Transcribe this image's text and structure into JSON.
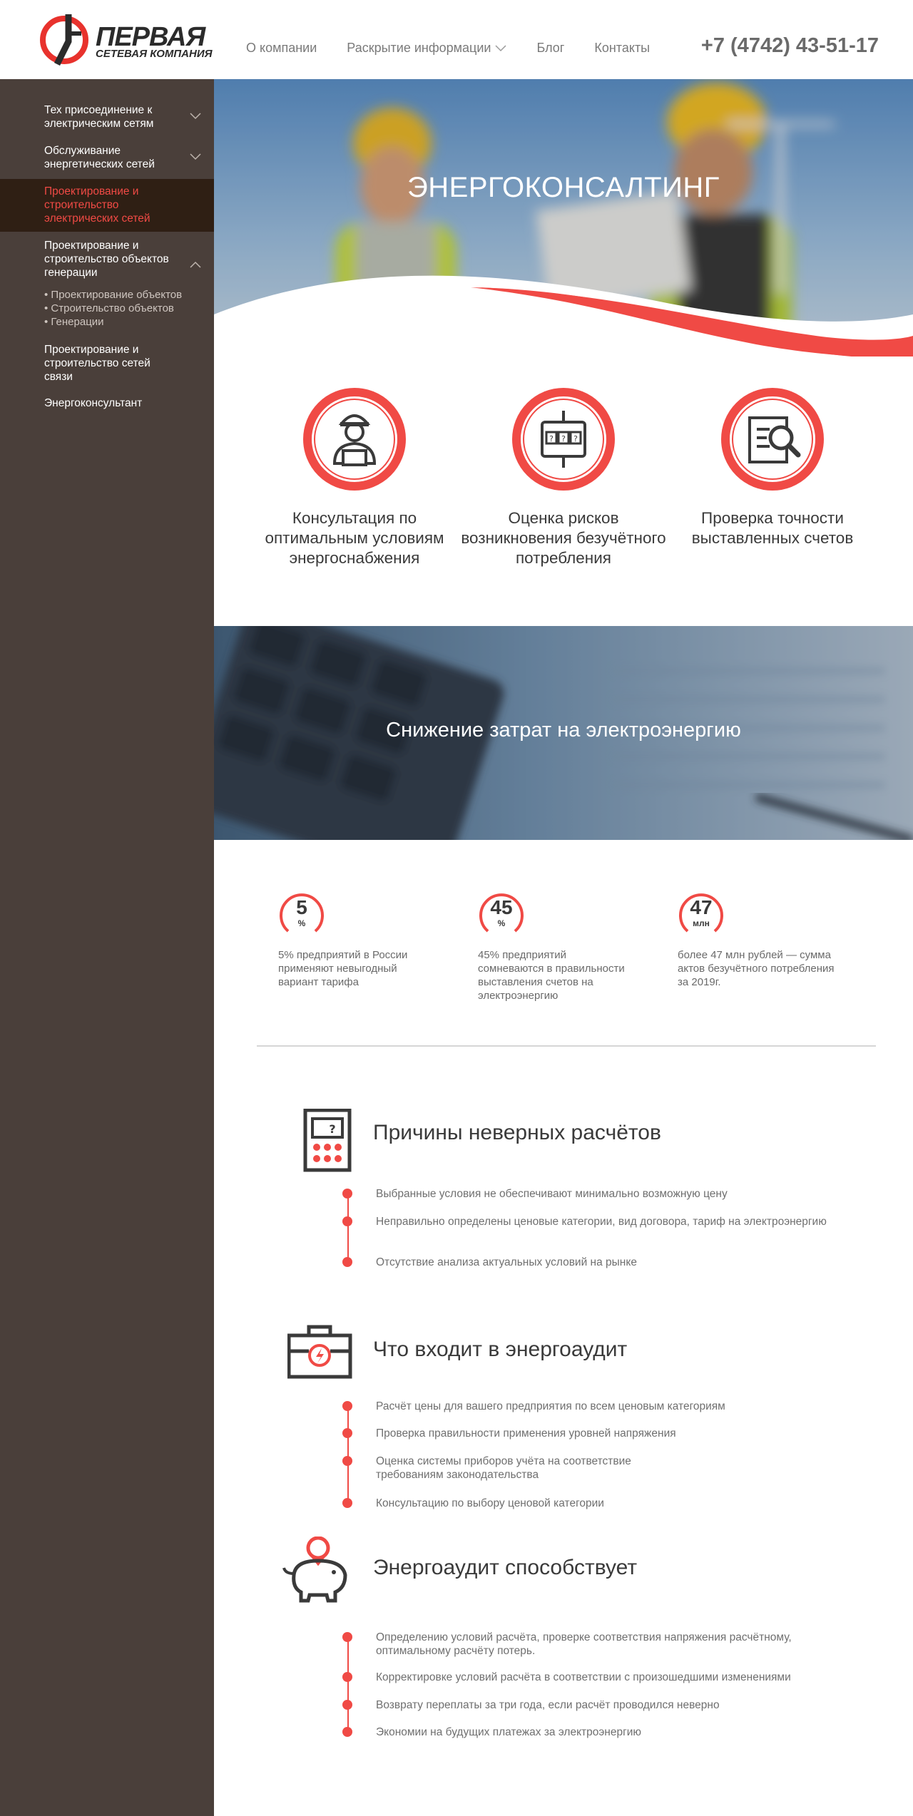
{
  "header": {
    "logo_title": "ПЕРВАЯ",
    "logo_subtitle": "СЕТЕВАЯ КОМПАНИЯ",
    "nav": [
      "О компании",
      "Раскрытие информации",
      "Блог",
      "Контакты"
    ],
    "phone": "+7 (4742) 43-51-17"
  },
  "sidebar": {
    "items": [
      {
        "label": "Тех присоединение к электрическим сетям"
      },
      {
        "label": "Обслуживание энергетических сетей"
      },
      {
        "label": "Проектирование и строительство электрических сетей"
      },
      {
        "label": "Проектирование и строительство объектов генерации"
      },
      {
        "label": "Проектирование и строительство сетей связи"
      },
      {
        "label": "Энергоконсультант"
      }
    ],
    "subitems": [
      "• Проектирование объектов",
      "• Строительство объектов",
      "• Генерации"
    ]
  },
  "hero": {
    "title": "ЭНЕРГОКОНСАЛТИНГ"
  },
  "services": [
    {
      "label": "Консультация по оптимальным условиям энергоснабжения",
      "icon": "worker-icon"
    },
    {
      "label": "Оценка рисков возникновения безучётного потребления",
      "icon": "meter-icon"
    },
    {
      "label": "Проверка точности выставленных счетов",
      "icon": "document-search-icon"
    }
  ],
  "banner": {
    "title": "Снижение затрат на электроэнергию"
  },
  "stats": [
    {
      "number": "5",
      "unit": "%",
      "text": "5% предприятий в России применяют невыгодный вариант тарифа"
    },
    {
      "number": "45",
      "unit": "%",
      "text": "45% предприятий сомневаются в правильности выставления счетов на электроэнергию"
    },
    {
      "number": "47",
      "unit": "млн",
      "text": "более 47 млн рублей — сумма актов безучётного потребления за 2019г."
    }
  ],
  "sections": [
    {
      "title": "Причины неверных расчётов",
      "icon": "calculator-icon",
      "items": [
        "Выбранные условия не обеспечивают минимально возможную цену",
        "Неправильно определены ценовые категории, вид договора, тариф на электроэнергию",
        "Отсутствие анализа актуальных условий на рынке"
      ]
    },
    {
      "title": "Что входит в энергоаудит",
      "icon": "toolbox-icon",
      "items": [
        "Расчёт цены для вашего предприятия по всем ценовым категориям",
        "Проверка правильности применения уровней напряжения",
        "Оценка системы приборов учёта на соответствие требованиям законодательства",
        "Консультацию по выбору ценовой категории"
      ]
    },
    {
      "title": "Энергоаудит способствует",
      "icon": "piggy-bank-icon",
      "items": [
        "Определению условий расчёта, проверке соответствия напряжения расчётному, оптимальному расчёту потерь.",
        "Корректировке условий расчёта в соответствии с произошедшими изменениями",
        "Возврату переплаты за три года, если расчёт проводился неверно",
        "Экономии на будущих платежах за электроэнергию"
      ]
    }
  ],
  "colors": {
    "accent": "#f04a45",
    "sidebar": "#4a3f3a",
    "sidebar_active": "#2f1f14"
  }
}
